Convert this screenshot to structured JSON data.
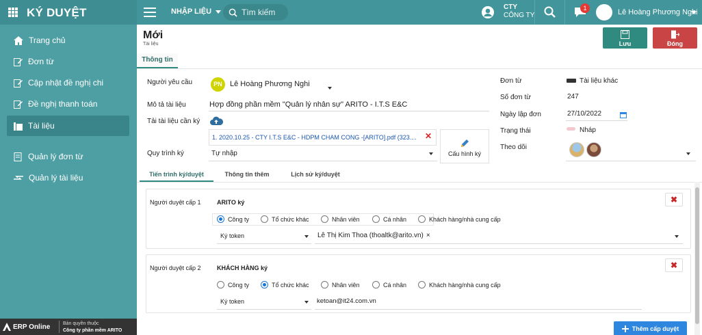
{
  "app": {
    "title": "KÝ DUYỆT"
  },
  "topbar": {
    "menu_label": "NHẬP LIỆU",
    "search_placeholder": "Tìm kiếm",
    "company_line1": "CTY",
    "company_line2": "CÔNG TY",
    "notification_count": "1",
    "user_name": "Lê Hoàng Phương Nghi"
  },
  "sidebar": {
    "items": [
      {
        "label": "Trang chủ",
        "icon": "home-icon"
      },
      {
        "label": "Đơn từ",
        "icon": "edit-icon"
      },
      {
        "label": "Cập nhật đề nghị chi",
        "icon": "edit-icon"
      },
      {
        "label": "Đề nghị thanh toán",
        "icon": "edit-icon"
      },
      {
        "label": "Tài liệu",
        "icon": "folder-icon",
        "active": true
      },
      {
        "label": "Quản lý đơn từ",
        "icon": "document-icon"
      },
      {
        "label": "Quản lý tài liệu",
        "icon": "transfer-icon"
      }
    ],
    "footer": {
      "brand": "ERP Online",
      "copyright_line1": "Bản quyền thuộc",
      "copyright_line2": "Công ty phần mềm ARITO"
    }
  },
  "page": {
    "title": "Mới",
    "subtitle": "Tài liệu",
    "save_label": "Lưu",
    "close_label": "Đóng",
    "tab_info": "Thông tin"
  },
  "form": {
    "requester_label": "Người yêu cầu",
    "requester_initials": "PN",
    "requester_value": "Lê Hoàng Phương Nghi",
    "description_label": "Mô tả tài liệu",
    "description_value": "Hợp đồng phần mềm \"Quản lý nhân sự\" ARITO - I.T.S E&C",
    "upload_label": "Tải tài liệu cần ký",
    "file_name": "1. 2020.10.25 - CTY I.T.S E&C - HDPM CHAM CONG -[ARITO].pdf (323....",
    "workflow_label": "Quy trình ký",
    "workflow_value": "Tự nhập",
    "config_label": "Cấu hình ký",
    "doc_type_label": "Đơn từ",
    "doc_type_value": "Tài liệu khác",
    "doc_no_label": "Số đơn từ",
    "doc_no_value": "247",
    "date_label": "Ngày lập đơn",
    "date_value": "27/10/2022",
    "status_label": "Trạng thái",
    "status_value": "Nháp",
    "follow_label": "Theo dõi"
  },
  "subtabs": [
    {
      "label": "Tiến trình ký/duyệt",
      "active": true
    },
    {
      "label": "Thông tin thêm"
    },
    {
      "label": "Lịch sử ký/duyệt"
    }
  ],
  "levels": [
    {
      "level_label": "Người duyệt cấp 1",
      "title": "ARITO ký",
      "options": [
        "Công ty",
        "Tổ chức khác",
        "Nhân viên",
        "Cá nhân",
        "Khách hàng/nhà cung cấp"
      ],
      "selected": "Công ty",
      "sign_type": "Ký token",
      "signer": "Lê Thị Kim Thoa (thoaltk@arito.vn)"
    },
    {
      "level_label": "Người duyệt cấp 2",
      "title": "KHÁCH HÀNG ký",
      "options": [
        "Công ty",
        "Tổ chức khác",
        "Nhân viên",
        "Cá nhân",
        "Khách hàng/nhà cung cấp"
      ],
      "selected": "Tổ chức khác",
      "sign_type": "Ký token",
      "signer": "ketoan@it24.com.vn"
    }
  ],
  "add_level_label": "Thêm cấp duyệt",
  "colors": {
    "topbar": "#42959a",
    "sidebar": "#4e9fa3",
    "save": "#2f8a7f",
    "close": "#c94545",
    "accent_blue": "#2e86de"
  }
}
